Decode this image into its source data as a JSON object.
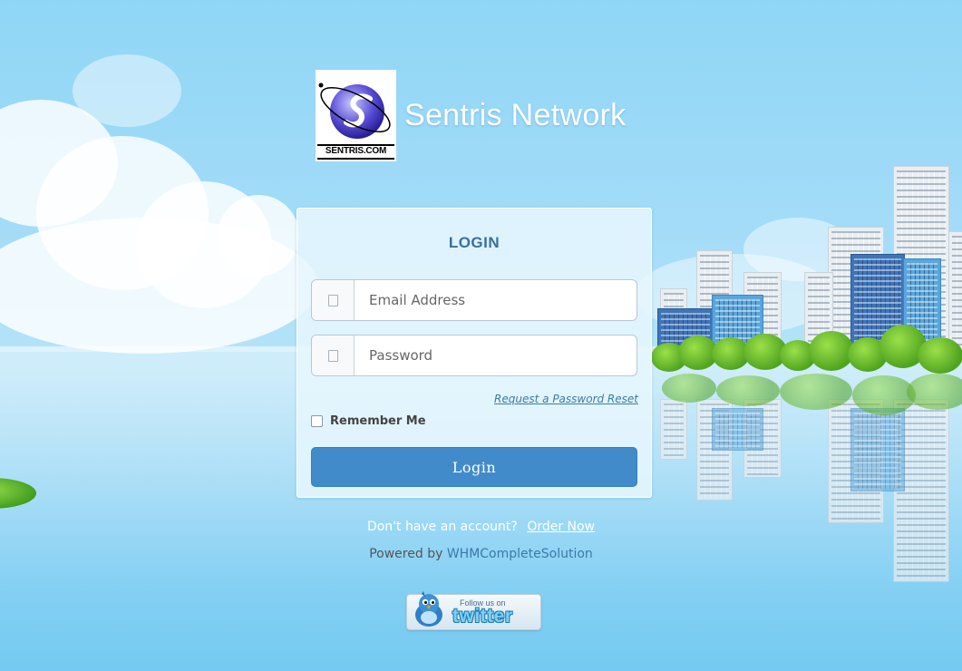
{
  "header": {
    "logo_text": "SENTRIS.COM",
    "site_name": "Sentris Network"
  },
  "login": {
    "title": "LOGIN",
    "email": {
      "placeholder": "Email Address",
      "icon": "user-icon"
    },
    "password": {
      "placeholder": "Password",
      "icon": "lock-icon"
    },
    "reset_link": "Request a Password Reset",
    "remember_label": "Remember Me",
    "remember_checked": false,
    "submit_label": "Login"
  },
  "footer": {
    "signup_prompt": "Don't have an account?",
    "signup_link": "Order Now",
    "powered_prefix": "Powered by",
    "powered_link": "WHMCompleteSolution",
    "twitter_small": "Follow us on",
    "twitter_big": "twitter"
  },
  "colors": {
    "accent": "#428bca",
    "title": "#3a6f9b",
    "link": "#3d79a8"
  }
}
